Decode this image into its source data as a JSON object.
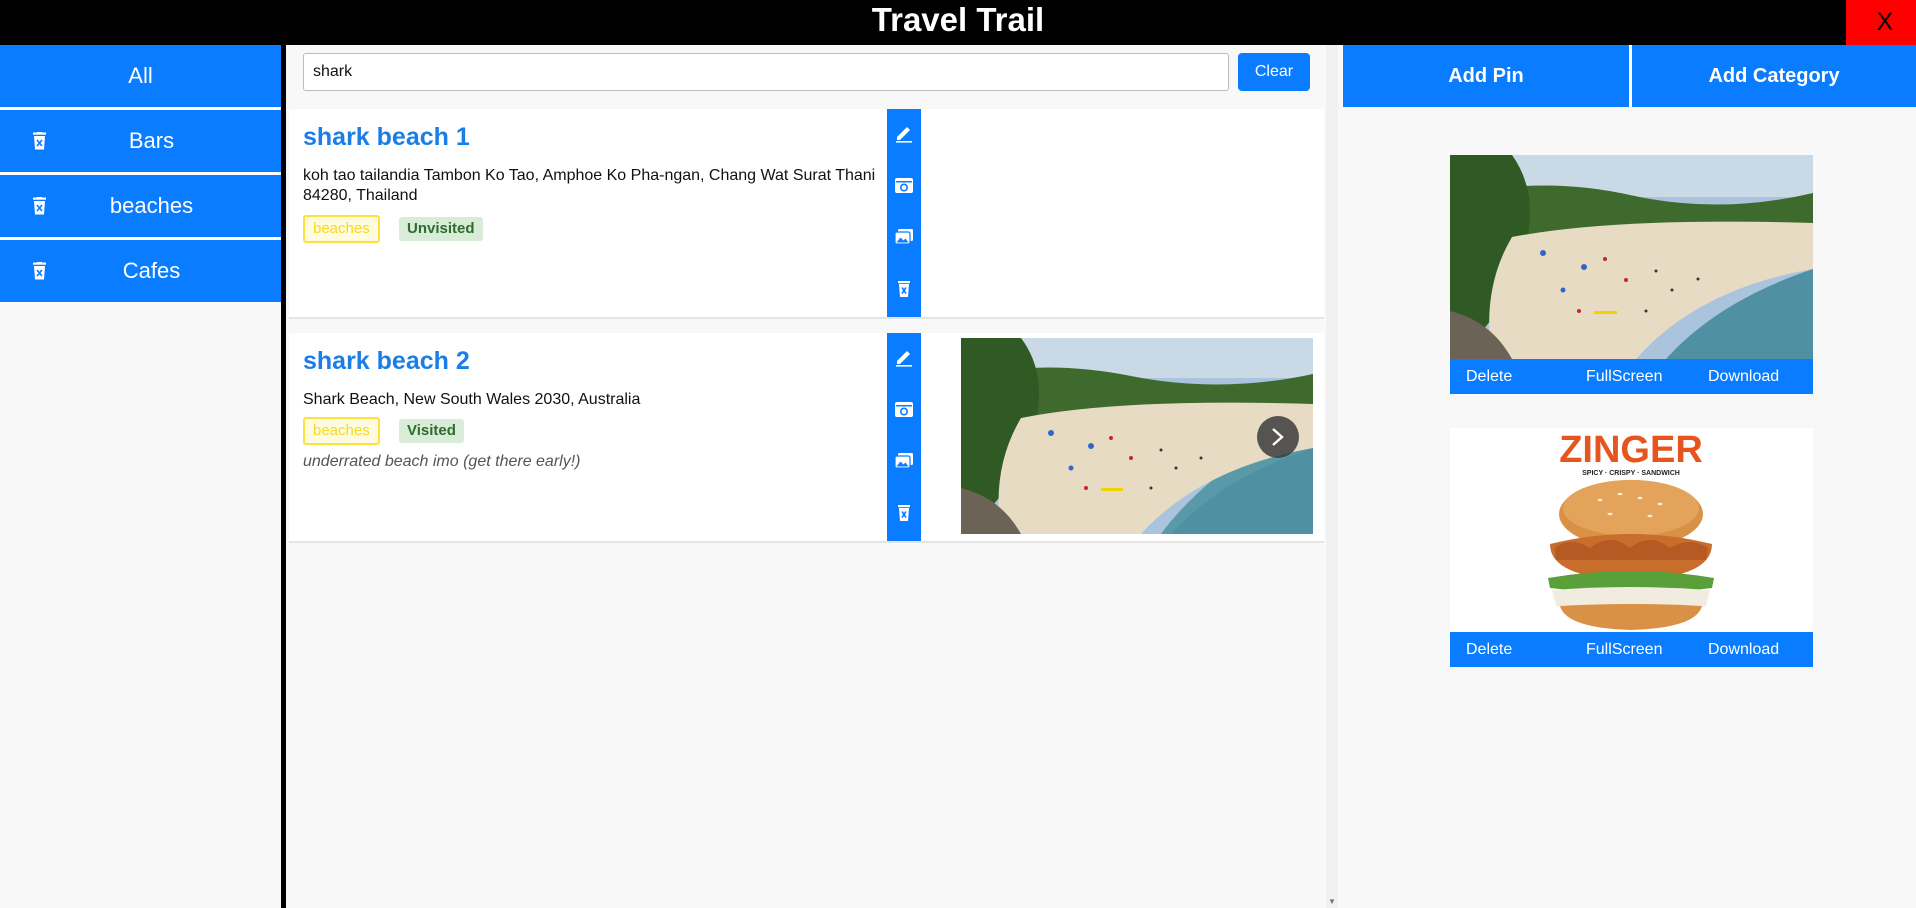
{
  "app": {
    "title": "Travel Trail",
    "close_label": "X"
  },
  "sidebar": {
    "items": [
      {
        "label": "All"
      },
      {
        "label": "Bars"
      },
      {
        "label": "beaches"
      },
      {
        "label": "Cafes"
      }
    ]
  },
  "search": {
    "value": "shark",
    "clear_label": "Clear"
  },
  "pins": [
    {
      "title": "shark beach 1",
      "address_line1": "koh tao tailandia Tambon Ko Tao, Amphoe Ko Pha-ngan, Chang Wat Surat Thani",
      "address_line2": "84280, Thailand",
      "category": "beaches",
      "status": "Unvisited",
      "note": "",
      "actions": [
        "pencil-icon",
        "camera-icon",
        "gallery-icon",
        "trash-icon"
      ]
    },
    {
      "title": "shark beach 2",
      "address_line1": "Shark Beach, New South Wales 2030, Australia",
      "address_line2": "",
      "category": "beaches",
      "status": "Visited",
      "note": "underrated beach imo (get there early!)",
      "actions": [
        "pencil-icon",
        "camera-icon",
        "gallery-icon",
        "trash-icon"
      ]
    }
  ],
  "right_panel": {
    "add_pin_label": "Add Pin",
    "add_category_label": "Add Category",
    "gallery": [
      {
        "image": "beach-photo",
        "delete_label": "Delete",
        "fullscreen_label": "FullScreen",
        "download_label": "Download"
      },
      {
        "image": "zinger-burger-photo",
        "brand_text": "ZINGER",
        "brand_subtext": "SPICY · CRISPY · SANDWICH",
        "delete_label": "Delete",
        "fullscreen_label": "FullScreen",
        "download_label": "Download"
      }
    ]
  },
  "colors": {
    "accent": "#0a7cff",
    "header": "#000000",
    "close": "#ff0000",
    "title_link": "#1a7ee8",
    "tag_category": "#ffe13a",
    "tag_status": "#d8ecd8"
  }
}
